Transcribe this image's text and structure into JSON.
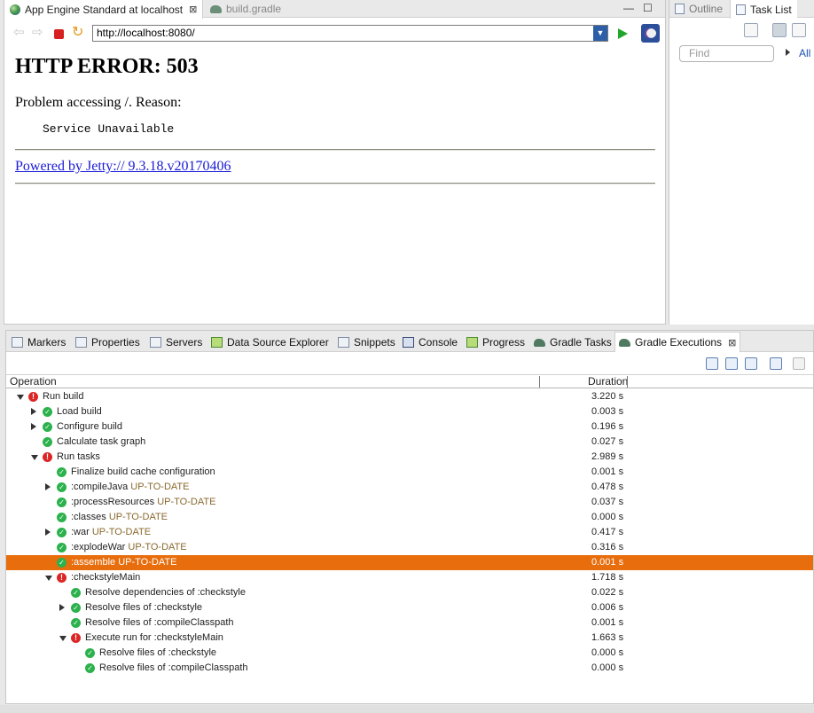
{
  "editor": {
    "tabs": [
      {
        "label": "App Engine Standard at localhost",
        "icon": "globe-icon",
        "active": true
      },
      {
        "label": "build.gradle",
        "icon": "gradle-elephant-icon",
        "active": false
      }
    ],
    "window_controls": {
      "minimize": "—",
      "maximize": "☐"
    }
  },
  "browser": {
    "url": "http://localhost:8080/",
    "page": {
      "heading": "HTTP ERROR: 503",
      "reason_line": "Problem accessing /. Reason:",
      "reason_detail": "Service Unavailable",
      "link_text": "Powered by Jetty:// 9.3.18.v20170406"
    }
  },
  "right_panel": {
    "tabs": [
      {
        "label": "Outline",
        "active": false
      },
      {
        "label": "Task List",
        "active": true
      }
    ],
    "find_placeholder": "Find",
    "all_label": "All"
  },
  "bottom_panel": {
    "tabs": [
      {
        "label": "Markers"
      },
      {
        "label": "Properties"
      },
      {
        "label": "Servers"
      },
      {
        "label": "Data Source Explorer"
      },
      {
        "label": "Snippets"
      },
      {
        "label": "Console"
      },
      {
        "label": "Progress"
      },
      {
        "label": "Gradle Tasks"
      },
      {
        "label": "Gradle Executions",
        "active": true
      }
    ],
    "columns": {
      "operation": "Operation",
      "duration": "Duration"
    },
    "rows": [
      {
        "label": "Run build",
        "state": "",
        "duration": "3.220 s",
        "status": "failed",
        "expander": "open",
        "depth": 0
      },
      {
        "label": "Load build",
        "state": "",
        "duration": "0.003 s",
        "status": "success",
        "expander": "closed",
        "depth": 1
      },
      {
        "label": "Configure build",
        "state": "",
        "duration": "0.196 s",
        "status": "success",
        "expander": "closed",
        "depth": 1
      },
      {
        "label": "Calculate task graph",
        "state": "",
        "duration": "0.027 s",
        "status": "success",
        "expander": "none",
        "depth": 1
      },
      {
        "label": "Run tasks",
        "state": "",
        "duration": "2.989 s",
        "status": "failed",
        "expander": "open",
        "depth": 1
      },
      {
        "label": "Finalize build cache configuration",
        "state": "",
        "duration": "0.001 s",
        "status": "success",
        "expander": "none",
        "depth": 2
      },
      {
        "label": ":compileJava",
        "state": "UP-TO-DATE",
        "duration": "0.478 s",
        "status": "success",
        "expander": "closed",
        "depth": 2
      },
      {
        "label": ":processResources",
        "state": "UP-TO-DATE",
        "duration": "0.037 s",
        "status": "success",
        "expander": "none",
        "depth": 2
      },
      {
        "label": ":classes",
        "state": "UP-TO-DATE",
        "duration": "0.000 s",
        "status": "success",
        "expander": "none",
        "depth": 2
      },
      {
        "label": ":war",
        "state": "UP-TO-DATE",
        "duration": "0.417 s",
        "status": "success",
        "expander": "closed",
        "depth": 2
      },
      {
        "label": ":explodeWar",
        "state": "UP-TO-DATE",
        "duration": "0.316 s",
        "status": "success",
        "expander": "none",
        "depth": 2
      },
      {
        "label": ":assemble",
        "state": "UP-TO-DATE",
        "duration": "0.001 s",
        "status": "success",
        "expander": "none",
        "depth": 2,
        "selected": true
      },
      {
        "label": ":checkstyleMain",
        "state": "",
        "duration": "1.718 s",
        "status": "failed",
        "expander": "open",
        "depth": 2
      },
      {
        "label": "Resolve dependencies of :checkstyle",
        "state": "",
        "duration": "0.022 s",
        "status": "success",
        "expander": "none",
        "depth": 3
      },
      {
        "label": "Resolve files of :checkstyle",
        "state": "",
        "duration": "0.006 s",
        "status": "success",
        "expander": "closed",
        "depth": 3
      },
      {
        "label": "Resolve files of :compileClasspath",
        "state": "",
        "duration": "0.001 s",
        "status": "success",
        "expander": "none",
        "depth": 3
      },
      {
        "label": "Execute run for :checkstyleMain",
        "state": "",
        "duration": "1.663 s",
        "status": "failed",
        "expander": "open",
        "depth": 3
      },
      {
        "label": "Resolve files of :checkstyle",
        "state": "",
        "duration": "0.000 s",
        "status": "success",
        "expander": "none",
        "depth": 4
      },
      {
        "label": "Resolve files of :compileClasspath",
        "state": "",
        "duration": "0.000 s",
        "status": "success",
        "expander": "none",
        "depth": 4
      }
    ]
  },
  "colors": {
    "selection": "#e86d0d",
    "success": "#2bb24c",
    "failed": "#dc2525",
    "state_text": "#8a6a2e",
    "link": "#1a1ad8"
  }
}
